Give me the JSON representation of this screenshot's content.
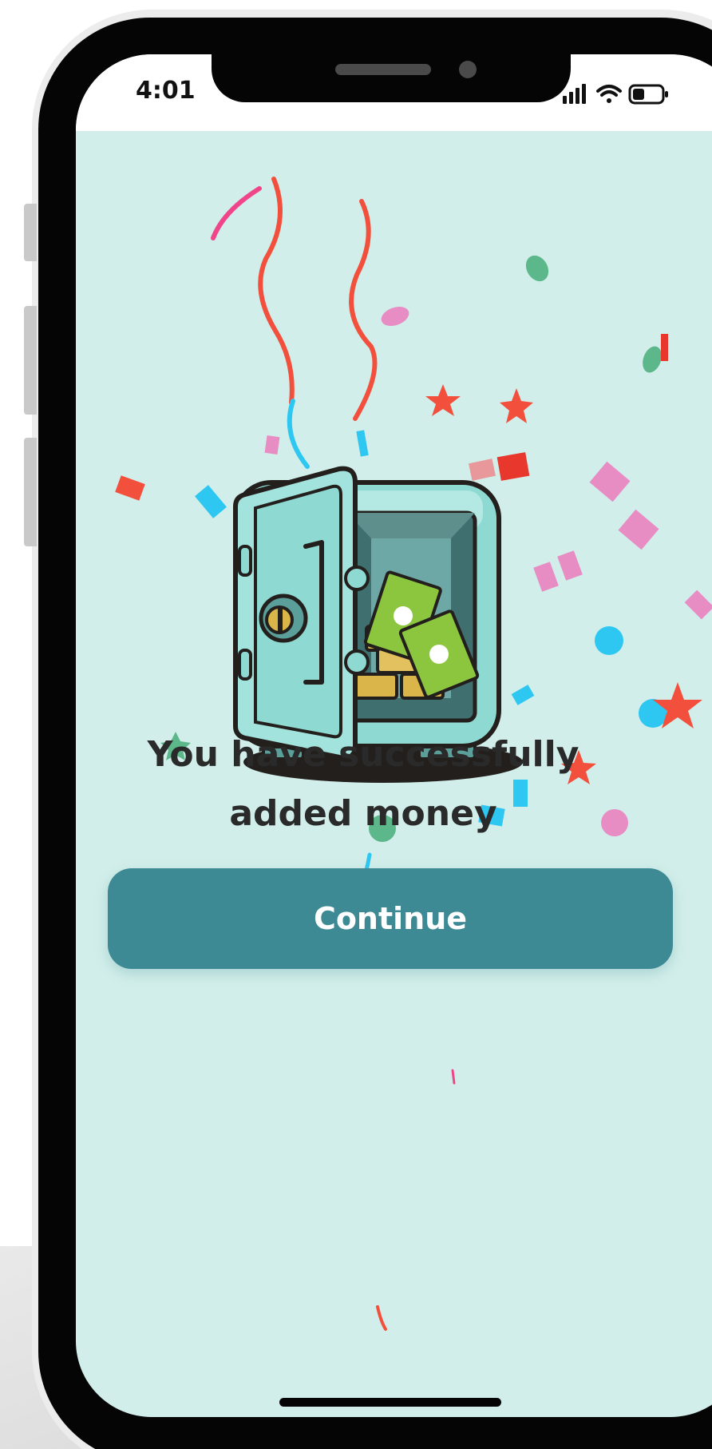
{
  "status_bar": {
    "time": "4:01",
    "icons": [
      "cellular-signal-icon",
      "wifi-icon",
      "battery-icon"
    ]
  },
  "success_screen": {
    "message": "You have successfully added money",
    "illustration_icon": "open-safe-with-money-icon",
    "decoration": "confetti",
    "continue_label": "Continue"
  },
  "colors": {
    "screen_background": "#d2eeea",
    "button_background": "#3d8a95",
    "button_text": "#ffffff",
    "message_text": "#2a2a2a",
    "safe_body": "#8fd9d3",
    "cash_green": "#8cc63f",
    "gold": "#d9b54a"
  }
}
